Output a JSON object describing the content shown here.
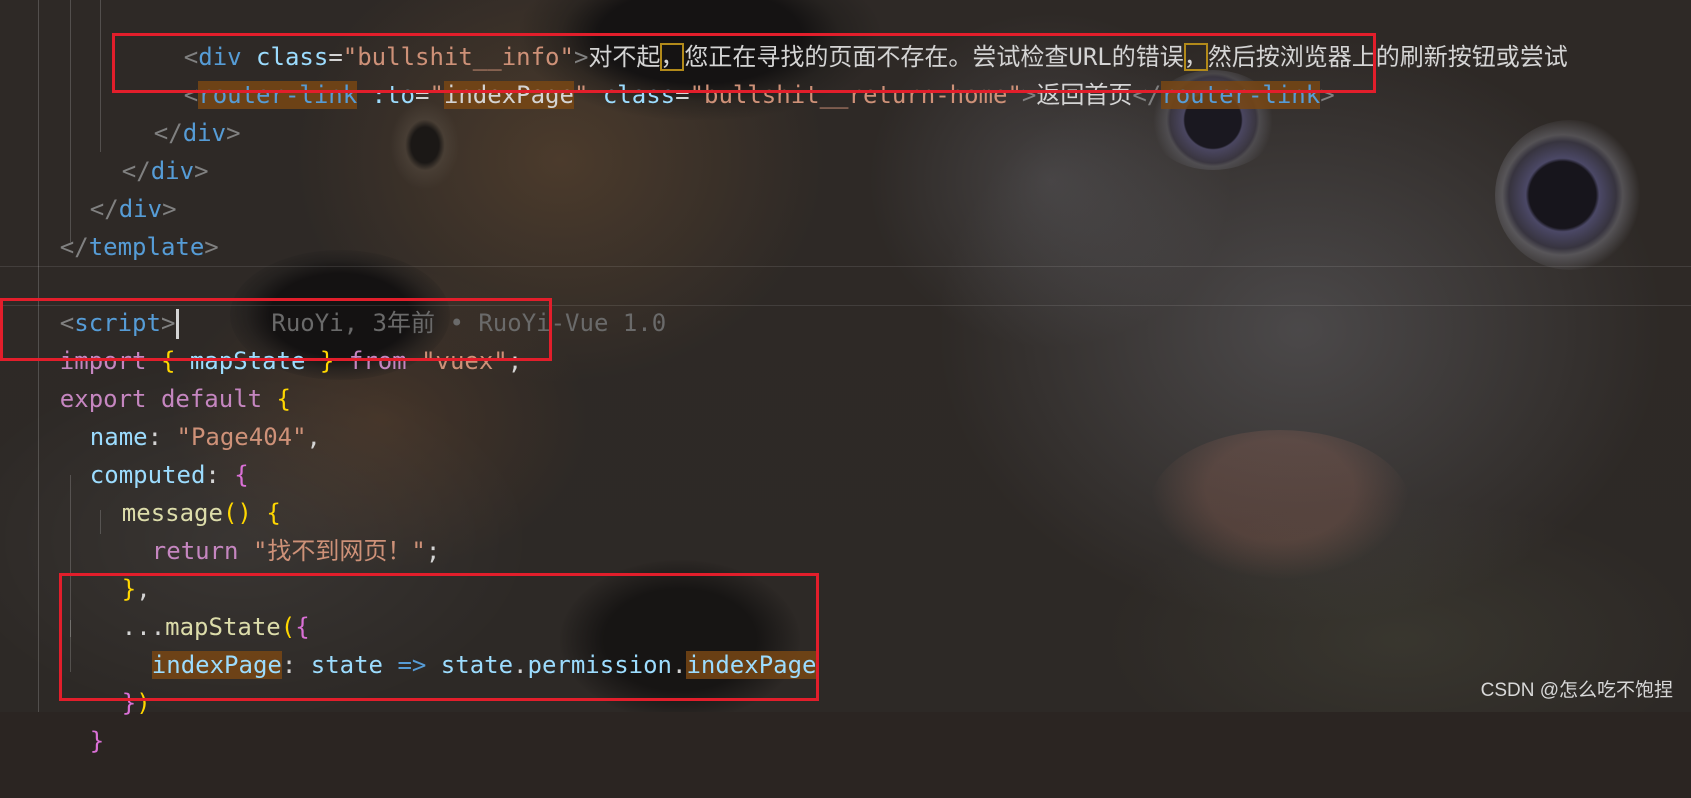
{
  "code_lines": [
    {
      "id": "l1"
    },
    {
      "id": "l2"
    }
  ],
  "line1": {
    "open": "<",
    "tag": "div",
    "attr": " class",
    "eq": "=",
    "str": "\"bullshit__info\"",
    "close": ">",
    "text_a": "对不起",
    "comma1": "，",
    "text_b": "您正在寻找的页面不存在。尝试检查URL的错误",
    "comma2": "，",
    "text_c": "然后按浏览器上的刷新按钮或尝试"
  },
  "line2": {
    "open": "<",
    "tag": "router-link",
    "attr1": " :to",
    "eq1": "=",
    "q1": "\"",
    "val1": "indexPage",
    "q2": "\"",
    "attr2": " class",
    "eq2": "=",
    "str2": "\"bullshit__return-home\"",
    "close": ">",
    "text": "返回首页",
    "open_end": "</",
    "tag_end": "router-link",
    "close_end": ">"
  },
  "line3": {
    "open": "</",
    "tag": "div",
    "close": ">"
  },
  "line4": {
    "open": "</",
    "tag": "div",
    "close": ">"
  },
  "line5": {
    "open": "</",
    "tag": "div",
    "close": ">"
  },
  "line6": {
    "open": "</",
    "tag": "template",
    "close": ">"
  },
  "line8": {
    "open": "<",
    "tag": "script",
    "close": ">",
    "blame": "RuoYi, 3年前 • RuoYi-Vue 1.0"
  },
  "line9": {
    "kw1": "import",
    "b1": " { ",
    "name": "mapState",
    "b2": " } ",
    "kw2": "from",
    "sp": " ",
    "str": "\"vuex\"",
    "semi": ";"
  },
  "line10": {
    "kw1": "export",
    "kw2": " default",
    "sp": " ",
    "b": "{"
  },
  "line11": {
    "key": "name",
    "colon": ": ",
    "str": "\"Page404\"",
    "comma": ","
  },
  "line12": {
    "key": "computed",
    "colon": ": ",
    "b": "{"
  },
  "line13": {
    "fn": "message",
    "paren": "()",
    "sp": " ",
    "b": "{"
  },
  "line14": {
    "kw": "return",
    "sp": " ",
    "str": "\"找不到网页！\"",
    "semi": ";"
  },
  "line15": {
    "b": "}",
    "comma": ","
  },
  "line16": {
    "spread": "...",
    "fn": "mapState",
    "paren": "(",
    "b": "{"
  },
  "line17": {
    "key": "indexPage",
    "colon": ": ",
    "p1": "state",
    "arrow": " => ",
    "p2": "state",
    "dot1": ".",
    "p3": "permission",
    "dot2": ".",
    "p4": "indexPage"
  },
  "line18": {
    "b": "}",
    "paren": ")"
  },
  "line19": {
    "b": "}"
  },
  "watermark": "CSDN @怎么吃不饱捏"
}
